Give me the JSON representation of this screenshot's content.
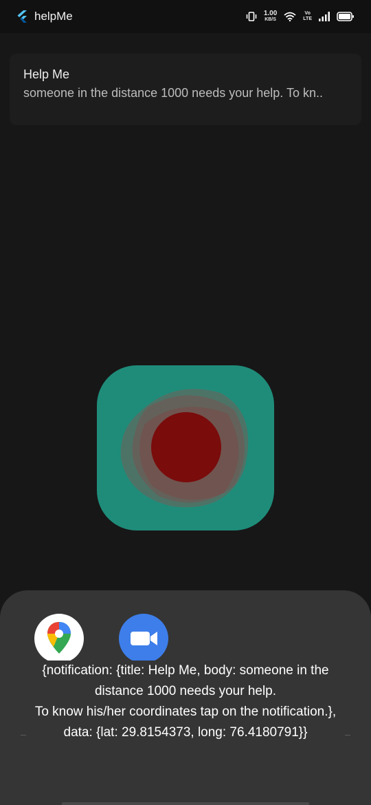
{
  "status_bar": {
    "app_name": "helpMe",
    "net_speed_value": "1.00",
    "net_speed_unit": "KB/S",
    "volte_top": "Vo",
    "volte_bottom": "LTE"
  },
  "notification": {
    "title": "Help Me",
    "body": "someone in the distance 1000 needs your help. To kn.."
  },
  "sos_button": {
    "accent_color": "#1f8c7a",
    "core_color": "#7a0c0c"
  },
  "bottom_sheet": {
    "apps": [
      {
        "icon": "google-maps-icon"
      },
      {
        "icon": "video-call-icon"
      }
    ],
    "message": "{notification: {title: Help Me, body: someone in the distance 1000 needs your help.\nTo know his/her coordinates tap on the notification.}, data: {lat: 29.8154373, long: 76.4180791}}"
  }
}
